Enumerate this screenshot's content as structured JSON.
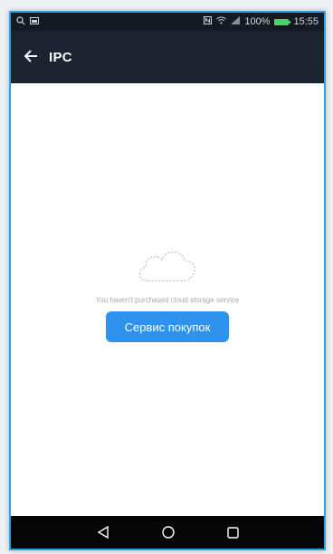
{
  "status_bar": {
    "left_icons": [
      "search-icon",
      "image-icon"
    ],
    "right_icons": [
      "nfc-icon",
      "wifi-icon",
      "signal-icon",
      "battery-icon"
    ],
    "battery": "100%",
    "time": "15:55"
  },
  "app_bar": {
    "back_icon": "arrow-left-icon",
    "title": "IPC"
  },
  "empty_state": {
    "icon": "cloud-outline-icon",
    "message": "You haven't purchased cloud storage service",
    "button_label": "Сервис покупок"
  },
  "nav_bar": {
    "buttons": [
      "back-triangle-icon",
      "home-circle-icon",
      "recents-square-icon"
    ]
  },
  "colors": {
    "accent": "#2e93ee",
    "app_bar": "#1b2430",
    "status_bar": "#151a22",
    "nav_bar": "#050505",
    "frame_border": "#29a3e6",
    "battery": "#46d36a"
  }
}
